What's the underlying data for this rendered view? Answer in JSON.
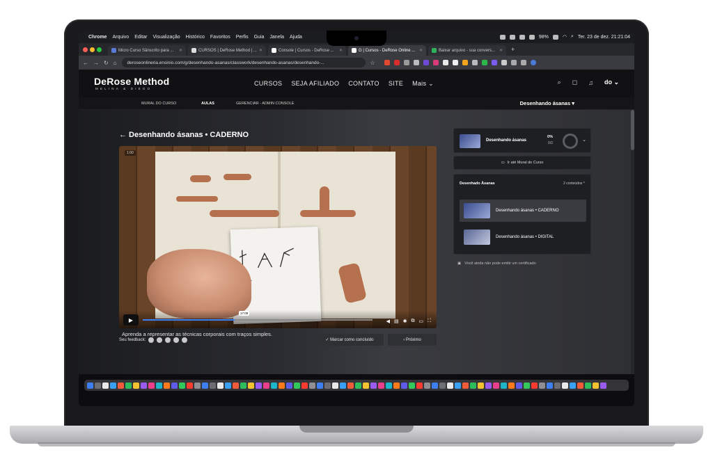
{
  "menubar": {
    "app": "Chrome",
    "items": [
      "Arquivo",
      "Editar",
      "Visualização",
      "Histórico",
      "Favoritos",
      "Perfis",
      "Guia",
      "Janela",
      "Ajuda"
    ],
    "battery": "98%",
    "clock": "Ter. 23 de dez. 21:21:04"
  },
  "tabs": [
    {
      "label": "Micro Curso Sânscrito para ...",
      "active": false
    },
    {
      "label": "CURSOS | DeRose Method | ...",
      "active": false
    },
    {
      "label": "Console | Cursos - DeRose ...",
      "active": false
    },
    {
      "label": "G | Cursos - DeRose Online ...",
      "active": true
    },
    {
      "label": "Baixar arquivo - sua convers...",
      "active": false
    }
  ],
  "address": {
    "url": "deroseonlineria.ensinio.com/g/desenhando-asanas/classwork/desenhando-asanas/desenhando-..."
  },
  "site": {
    "logo": "DeRose Method",
    "logo_sub": "MELINA & DIEGO",
    "nav": [
      "CURSOS",
      "SEJA AFILIADO",
      "CONTATO",
      "SITE",
      "Mais ⌄"
    ],
    "avatar": "do ⌄"
  },
  "subnav": {
    "mural": "MURAL DO CURSO",
    "aulas": "AULAS",
    "gerenciar": "GERENCIAR - ADMIN CONSOLE",
    "course_select": "Desenhando ásanas ▾"
  },
  "lesson": {
    "back_title": "←  Desenhando ásanas • CADERNO",
    "time_badge": "1:00",
    "seek_time": "17:09",
    "progress_fraction": 0.4,
    "feedback_label": "Seu feedback:",
    "mark_done": "✓  Marcar como concluído",
    "next": "›    Próximo",
    "description": "Aprenda a representar as técnicas corporais com traços simples."
  },
  "sidebar": {
    "course_title": "Desenhando ásanas",
    "course_progress": "0%",
    "course_progress_count": "0/2",
    "mural_link": "Ir até Mural do Curso",
    "module_title": "Desenhado Ásanas",
    "module_count": "2 conteúdos  ^",
    "lessons": [
      {
        "title": "Desenhando ásanas • CADERNO",
        "current": true
      },
      {
        "title": "Desenhando ásanas • DIGITAL",
        "current": false
      }
    ],
    "certificate": "Você ainda não pode emitir um certificado"
  },
  "colors": {
    "accent": "#3b82f6",
    "bg_dark": "#111113",
    "traffic_red": "#ff5f57",
    "traffic_yellow": "#febc2e",
    "traffic_green": "#28c840"
  }
}
